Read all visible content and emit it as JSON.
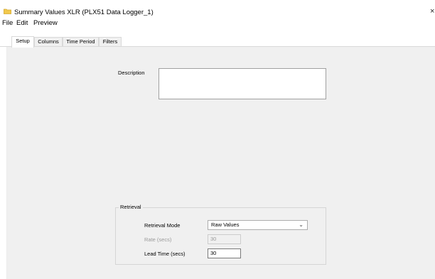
{
  "window": {
    "title": "Summary Values XLR (PLX51 Data Logger_1)",
    "close_glyph": "×",
    "icon": "folder-icon"
  },
  "menu": [
    "File",
    "Edit",
    "Preview"
  ],
  "tabs": [
    {
      "label": "Setup",
      "active": true
    },
    {
      "label": "Columns",
      "active": false
    },
    {
      "label": "Time Period",
      "active": false
    },
    {
      "label": "Filters",
      "active": false
    }
  ],
  "setup": {
    "description_label": "Description",
    "description_value": "",
    "retrieval": {
      "group_title": "Retrieval",
      "mode_label": "Retrieval Mode",
      "mode_value": "Raw Values",
      "rate_label": "Rate (secs)",
      "rate_value": "30",
      "lead_label": "Lead Time (secs)",
      "lead_value": "30"
    }
  },
  "colors": {
    "panel_bg": "#f0f0f0",
    "folder_icon": "#f2c94c",
    "disabled_text": "#9a9a9a"
  }
}
